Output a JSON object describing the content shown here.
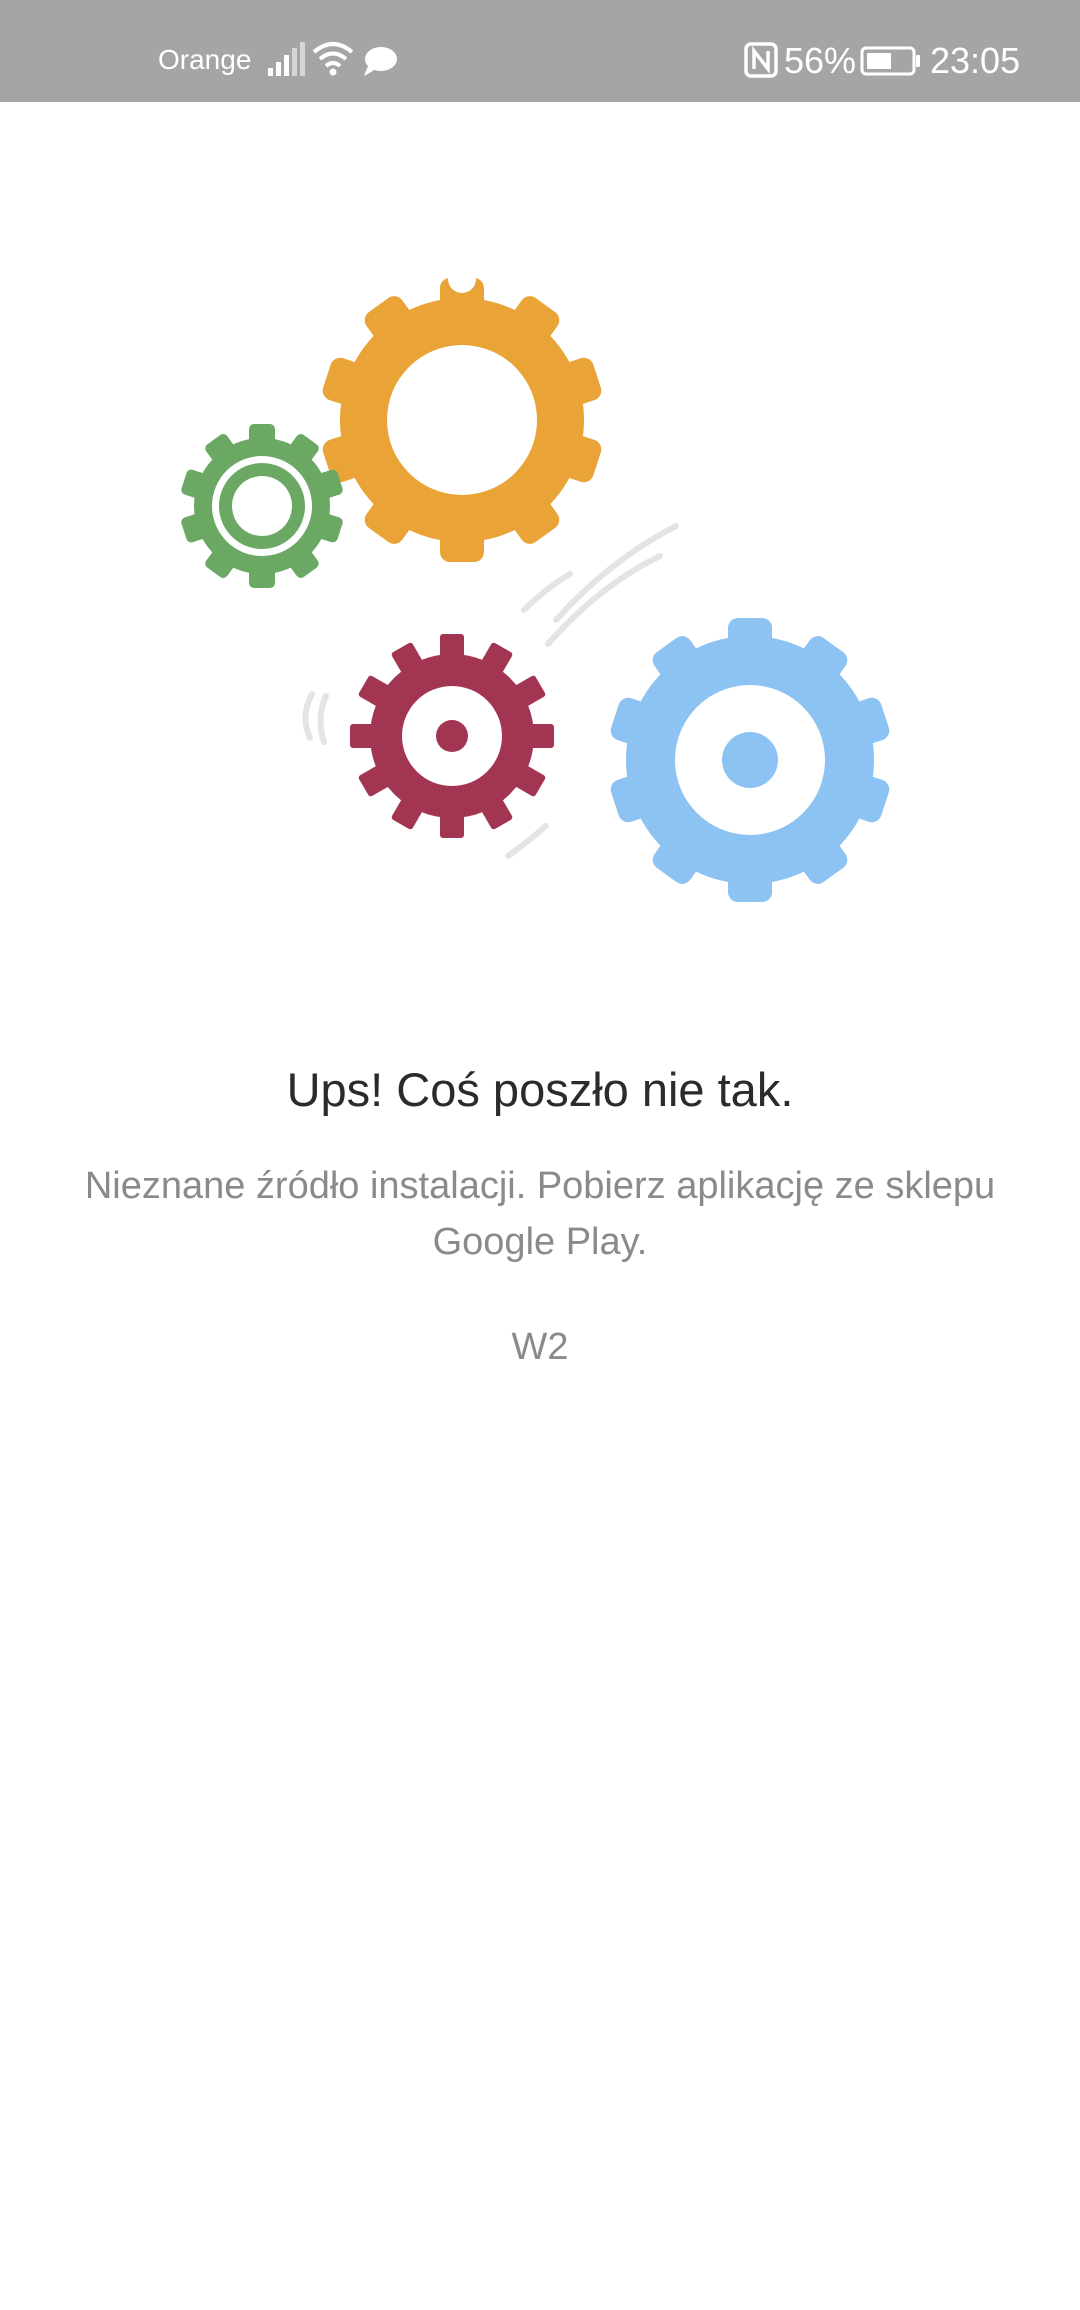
{
  "status_bar": {
    "carrier": "Orange",
    "battery_percent": "56%",
    "time": "23:05",
    "icons": [
      "signal-icon",
      "wifi-icon",
      "chat-bubble-icon",
      "nfc-icon",
      "battery-icon"
    ]
  },
  "illustration": {
    "icon": "gears-illustration",
    "colors": {
      "orange": "#eaa336",
      "green": "#6aa864",
      "red": "#a23552",
      "blue": "#8cc3f2",
      "motion_lines": "#e4e4e4"
    }
  },
  "error": {
    "title": "Ups! Coś poszło nie tak.",
    "message": "Nieznane źródło instalacji. Pobierz aplikację ze sklepu Google Play.",
    "code": "W2"
  }
}
